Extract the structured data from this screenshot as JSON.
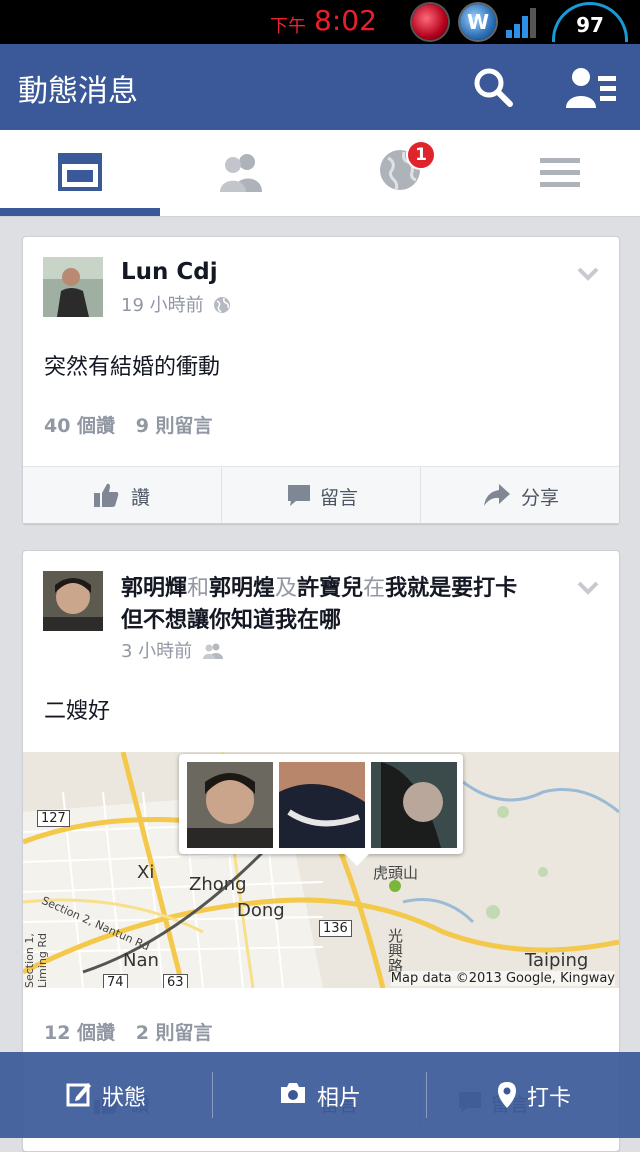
{
  "status_bar": {
    "ampm": "下午",
    "time": "8:02",
    "battery": "97"
  },
  "app_bar": {
    "title": "動態消息"
  },
  "tabs": {
    "notification_count": "1"
  },
  "posts": [
    {
      "author": "Lun Cdj",
      "time": "19 小時前",
      "text": "突然有結婚的衝動",
      "likes": "40 個讚",
      "comments": "9 則留言"
    },
    {
      "author_line1_a": "郭明輝",
      "and": "和",
      "author_line1_b": "郭明煌",
      "ji": "及",
      "author_line1_c": "許寶兒",
      "at": "在",
      "place_line1": "我就是要打卡",
      "place_line2": "但不想讓你知道我在哪",
      "time": "3 小時前",
      "text": "二嫂好",
      "likes": "12 個讚",
      "comments": "2 則留言",
      "map": {
        "labels": [
          "Xi",
          "Zhong",
          "Dong",
          "Nan",
          "Taiping",
          "虎頭山",
          "光興路",
          "Section 2, Nantun Rd",
          "Section 1, Liming Rd",
          "127",
          "136",
          "63",
          "74"
        ],
        "credit": "Map data ©2013 Google, Kingway"
      }
    }
  ],
  "actions": {
    "like": "讚",
    "comment": "留言",
    "share": "分享"
  },
  "bottom_bar": {
    "status": "狀態",
    "photo": "相片",
    "checkin": "打卡"
  }
}
